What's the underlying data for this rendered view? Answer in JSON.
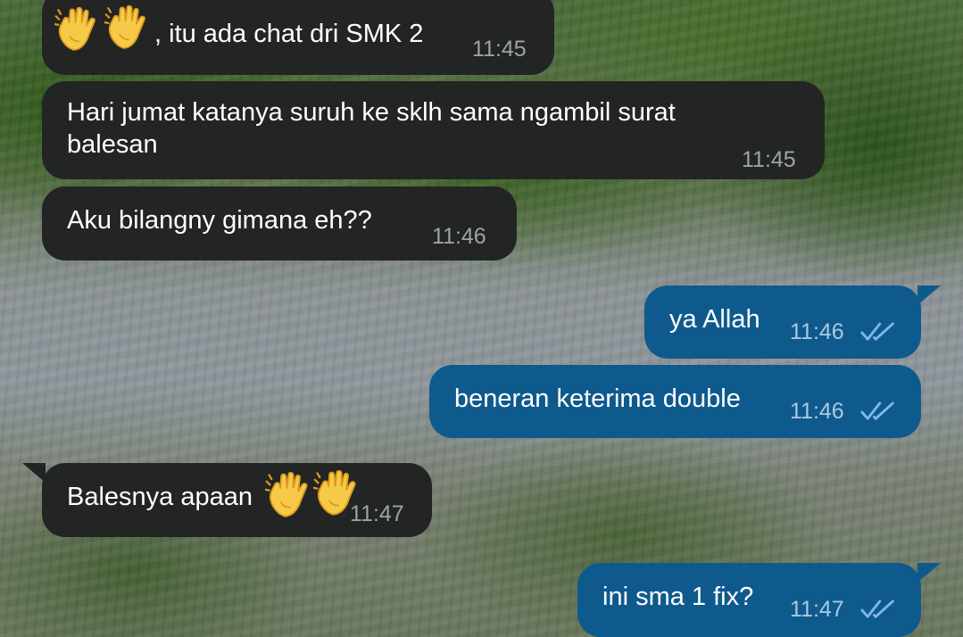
{
  "chat": {
    "colors": {
      "incoming_bubble": "#232424",
      "outgoing_bubble": "#0f5a8d",
      "incoming_time": "#9ea3a6",
      "outgoing_time": "#a9c9e2",
      "read_checks": "#7fb6e8"
    },
    "messages": [
      {
        "direction": "incoming",
        "text": ", itu ada chat dri SMK 2",
        "emoji": [
          "waving-hand-icon",
          "waving-hand-icon"
        ],
        "time": "11:45"
      },
      {
        "direction": "incoming",
        "text": "Hari jumat katanya suruh ke sklh sama ngambil surat\nbalesan",
        "time": "11:45"
      },
      {
        "direction": "incoming",
        "text": "Aku bilangny gimana eh??",
        "time": "11:46"
      },
      {
        "direction": "outgoing",
        "text": "ya Allah",
        "time": "11:46",
        "status_icon": "double-check-icon"
      },
      {
        "direction": "outgoing",
        "text": "beneran keterima double",
        "time": "11:46",
        "status_icon": "double-check-icon"
      },
      {
        "direction": "incoming",
        "text": "Balesnya apaan",
        "emoji": [
          "waving-hand-icon",
          "waving-hand-icon"
        ],
        "time": "11:47"
      },
      {
        "direction": "outgoing",
        "text": "ini sma 1 fix?",
        "time": "11:47",
        "status_icon": "double-check-icon"
      }
    ]
  }
}
